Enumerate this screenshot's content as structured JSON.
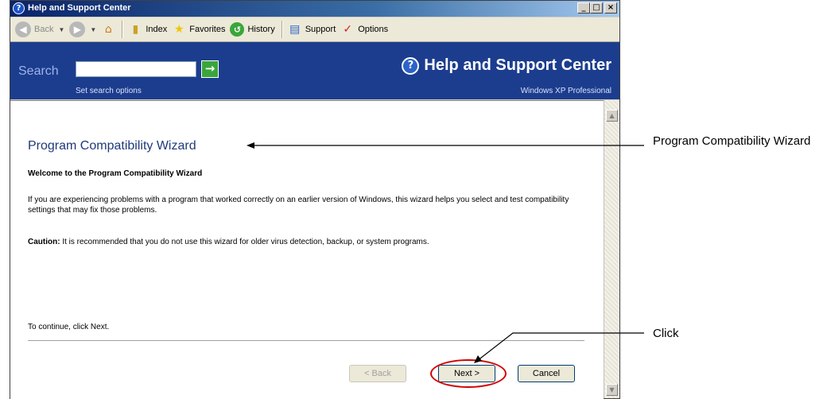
{
  "window": {
    "title": "Help and Support Center",
    "title_icon": "?",
    "controls": [
      "_",
      "□",
      "×"
    ]
  },
  "toolbar": {
    "back": "Back",
    "index": "Index",
    "favorites": "Favorites",
    "history": "History",
    "support": "Support",
    "options": "Options"
  },
  "search": {
    "label": "Search",
    "value": "",
    "go_icon": "→",
    "options_link": "Set search options"
  },
  "header": {
    "title": "Help and Support Center",
    "edition": "Windows XP Professional"
  },
  "wizard": {
    "title": "Program Compatibility Wizard",
    "welcome": "Welcome to the Program Compatibility Wizard",
    "paragraph": "If you are experiencing problems with a program that worked correctly on an earlier version of Windows, this wizard helps you select and test compatibility settings that may fix those problems.",
    "caution_label": "Caution:",
    "caution_text": " It is recommended that you do not use this wizard for older virus detection, backup, or system programs.",
    "continue": "To continue, click Next.",
    "back_button": "< Back",
    "next_button": "Next >",
    "cancel_button": "Cancel"
  },
  "annotations": {
    "title_callout": "Program Compatibility Wizard",
    "click_callout": "Click"
  },
  "colors": {
    "header_bg": "#1c3d8e",
    "highlight_ring": "#d40000",
    "title_text": "#1f3a7a"
  }
}
